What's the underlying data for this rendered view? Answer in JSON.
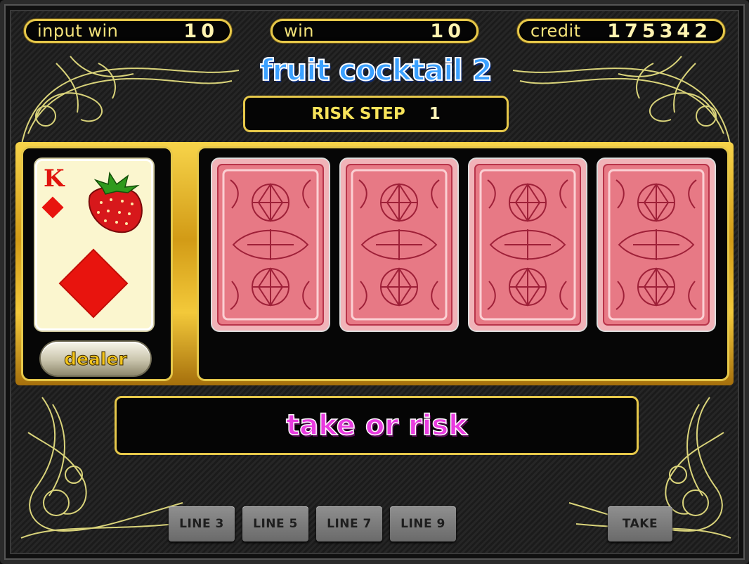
{
  "meters": {
    "input_win": {
      "label": "input win",
      "value": "10"
    },
    "win": {
      "label": "win",
      "value": "10"
    },
    "credit": {
      "label": "credit",
      "value": "175342"
    }
  },
  "title": "fruit cocktail 2",
  "risk": {
    "label": "RISK STEP",
    "value": "1"
  },
  "dealer_card": {
    "rank": "K",
    "suit": "diamond",
    "fruit": "strawberry-icon"
  },
  "dealer_button": "dealer",
  "player_cards": [
    {
      "state": "face-down"
    },
    {
      "state": "face-down"
    },
    {
      "state": "face-down"
    },
    {
      "state": "face-down"
    }
  ],
  "message": "take or risk",
  "buttons": {
    "line3": "LINE 3",
    "line5": "LINE 5",
    "line7": "LINE 7",
    "line9": "LINE 9",
    "take": "TAKE"
  },
  "colors": {
    "gold": "#e6c84a",
    "meter_text": "#f4e37a",
    "title_blue": "#3aa0ff",
    "message_pink": "#e93be0",
    "card_red": "#e8140e",
    "card_back": "#f0a9b0"
  }
}
